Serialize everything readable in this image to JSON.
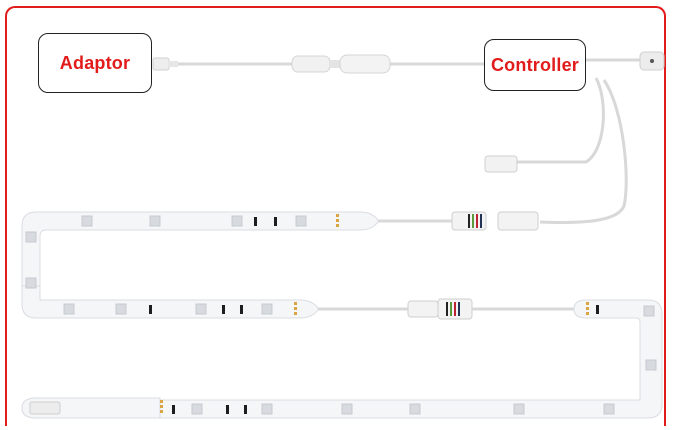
{
  "labels": {
    "adaptor": "Adaptor",
    "controller": "Controller"
  },
  "colors": {
    "frame": "#e21b1b",
    "label_text": "#e21b1b",
    "strip": "#f4f5f7",
    "strip_edge": "#d9dce1",
    "cable": "#d8d8d8",
    "led_chip": "#d7dbe0",
    "gold_pad": "#d9a441",
    "dark_pad": "#1e1e1e"
  }
}
